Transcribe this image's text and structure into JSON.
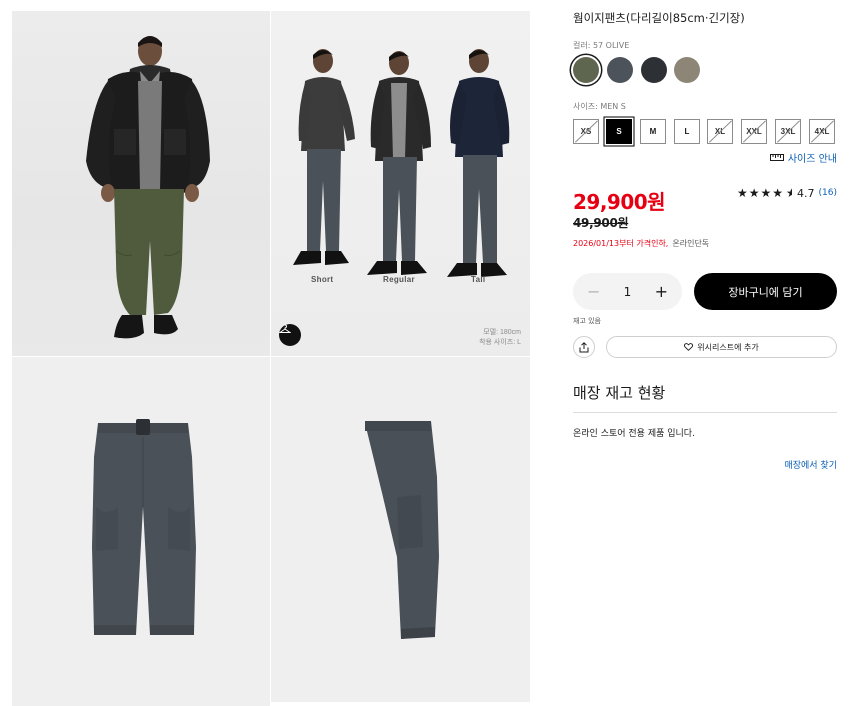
{
  "product": {
    "title": "웜이지팬츠(다리길이85cm·긴기장)",
    "color_label": "컬러: 57 OLIVE",
    "size_label": "사이즈: MEN S"
  },
  "colors": [
    {
      "name": "olive",
      "hex": "#5e6650",
      "selected": true
    },
    {
      "name": "gray",
      "hex": "#4c535a",
      "selected": false
    },
    {
      "name": "dark gray",
      "hex": "#2d3035",
      "selected": false
    },
    {
      "name": "beige",
      "hex": "#8d8677",
      "selected": false
    }
  ],
  "sizes": [
    {
      "label": "XS",
      "state": "soldout"
    },
    {
      "label": "S",
      "state": "selected"
    },
    {
      "label": "M",
      "state": "available"
    },
    {
      "label": "L",
      "state": "available"
    },
    {
      "label": "XL",
      "state": "soldout"
    },
    {
      "label": "XXL",
      "state": "soldout"
    },
    {
      "label": "3XL",
      "state": "soldout"
    },
    {
      "label": "4XL",
      "state": "soldout"
    }
  ],
  "size_guide": {
    "label": "사이즈 안내",
    "icon": "ruler-icon"
  },
  "price": {
    "current": "29,900원",
    "original": "49,900원",
    "note_date": "2026/01/13부터 가격인하,",
    "note_channel": "온라인단독",
    "accent_color": "#e60012"
  },
  "rating": {
    "stars": "★★★★",
    "half_star": "★",
    "score": "4.7",
    "count": "(16)",
    "value": 4.7
  },
  "quantity": {
    "minus": "−",
    "value": "1",
    "plus": "+"
  },
  "cart_button": "장바구니에 담기",
  "stock_status": "재고 있음",
  "wishlist_button": "위시리스트에 추가",
  "store": {
    "title": "매장 재고 현황",
    "note": "온라인 스토어 전용 제품 입니다.",
    "link": "매장에서 찾기"
  },
  "gallery": {
    "variant_labels": [
      "Short",
      "Regular",
      "Tall"
    ],
    "model_height": "모델: 180cm",
    "model_size": "착용 사이즈: L"
  }
}
